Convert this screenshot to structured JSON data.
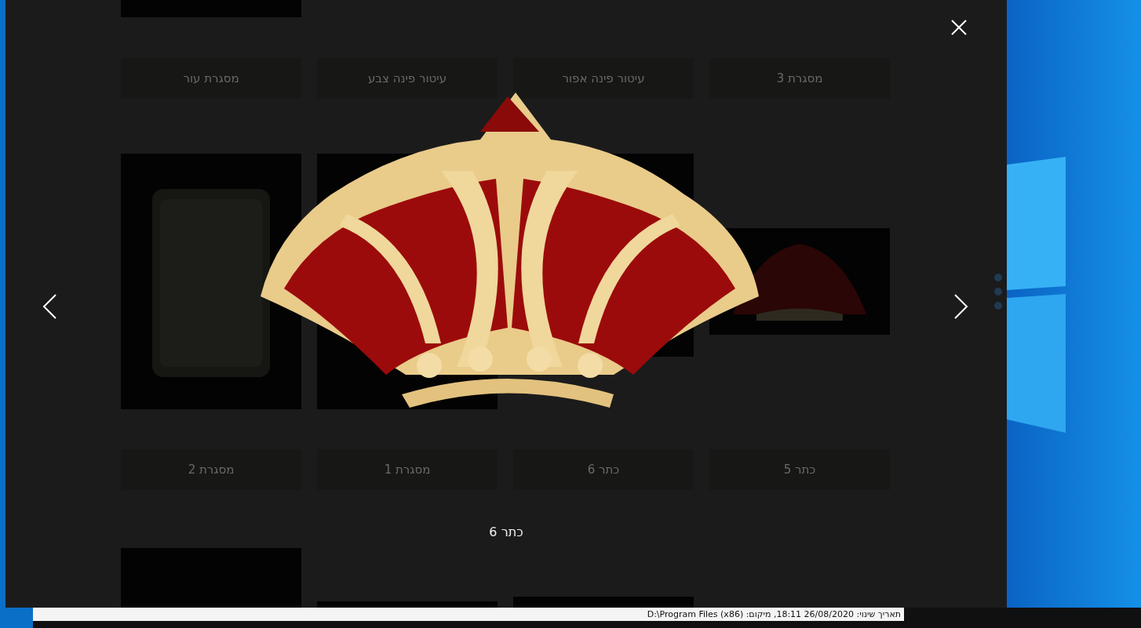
{
  "gallery": {
    "items": [
      {
        "label": "מסגרת 3"
      },
      {
        "label": "עיטור פינה אפור"
      },
      {
        "label": "עיטור פינה צבע"
      },
      {
        "label": "מסגרת עור"
      },
      {
        "label": "כתר 5"
      },
      {
        "label": "כתר 6"
      },
      {
        "label": "מסגרת 1"
      },
      {
        "label": "מסגרת 2"
      }
    ]
  },
  "lightbox": {
    "caption": "כתר 6"
  },
  "status_bar": {
    "text": "תאריך שינוי: 26/08/2020 18:11, מיקום: D:\\Program Files (x86)"
  }
}
